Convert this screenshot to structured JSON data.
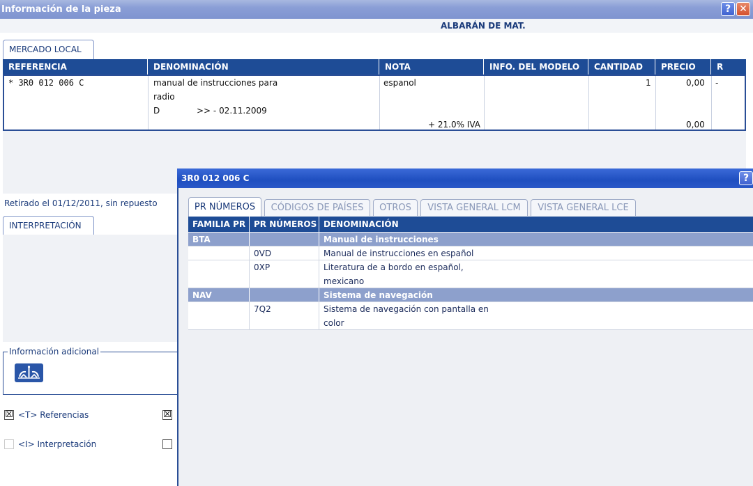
{
  "window": {
    "title": "Información de la pieza",
    "help": "?",
    "close": "✕"
  },
  "header": {
    "albaran": "ALBARÁN DE MAT."
  },
  "tabs": {
    "mercado_local": "MERCADO LOCAL",
    "interpretacion": "INTERPRETACIÓN"
  },
  "grid": {
    "columns": [
      "REFERENCIA",
      "DENOMINACIÓN",
      "NOTA",
      "INFO. DEL MODELO",
      "CANTIDAD",
      "PRECIO",
      "R"
    ],
    "row": {
      "referencia": "* 3R0 012 006 C",
      "denominacion_1": "manual de instrucciones para",
      "denominacion_2": "radio",
      "denominacion_3a": "D",
      "denominacion_3b": ">> - 02.11.2009",
      "nota": "espanol",
      "iva": "+ 21.0% IVA",
      "cantidad": "1",
      "precio": "0,00",
      "precio_total": "0,00",
      "r": "-"
    }
  },
  "status": {
    "retirado": "Retirado el 01/12/2011, sin repuesto"
  },
  "info_adicional": {
    "legend": "Información adicional"
  },
  "checks": {
    "referencias": {
      "label": "<T> Referencias",
      "checked": "☒"
    },
    "interpretacion": {
      "label": "<I> Interpretación"
    }
  },
  "popup": {
    "title": "3R0 012 006 C",
    "help": "?",
    "tabs": [
      "PR NÚMEROS",
      "CÓDIGOS DE PAÍSES",
      "OTROS",
      "VISTA GENERAL LCM",
      "VISTA GENERAL LCE"
    ],
    "columns": [
      "FAMILIA PR",
      "PR NÚMEROS",
      "DENOMINACIÓN"
    ],
    "rows": [
      {
        "familia": "BTA",
        "pr": "",
        "den": "Manual de instrucciones",
        "group": true
      },
      {
        "familia": "",
        "pr": "0VD",
        "den": "Manual de instrucciones en español"
      },
      {
        "familia": "",
        "pr": "0XP",
        "den": "Literatura de a bordo en español,",
        "den2": "mexicano"
      },
      {
        "familia": "NAV",
        "pr": "",
        "den": "Sistema de navegación",
        "group": true
      },
      {
        "familia": "",
        "pr": "7Q2",
        "den": "Sistema de navegación con pantalla en",
        "den2": "color"
      }
    ]
  }
}
